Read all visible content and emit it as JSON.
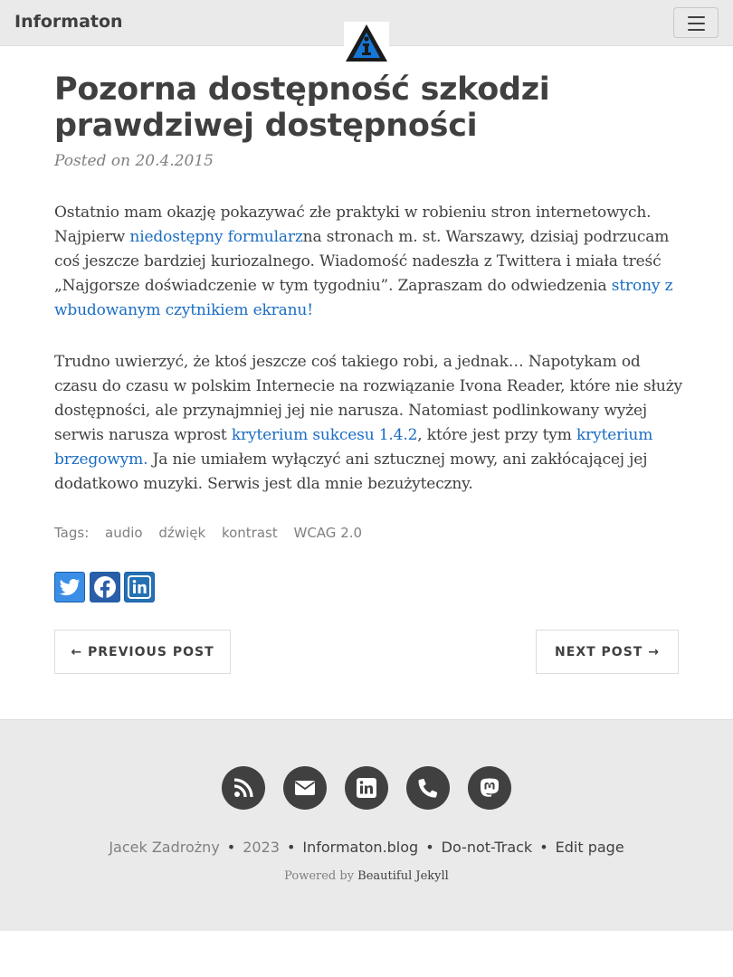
{
  "navbar": {
    "brand": "Informaton",
    "menu_icon": "hamburger-menu-icon",
    "logo_icon": "info-triangle-logo-icon"
  },
  "post": {
    "title": "Pozorna dostępność szkodzi prawdziwej dostępności",
    "posted_on": "Posted on 20.4.2015",
    "p1": {
      "t1": "Ostatnio mam okazję pokazywać złe praktyki w robieniu stron internetowych. Najpierw ",
      "link1": "niedostępny formularz",
      "t2": "na stronach m. st. Warszawy, dzisiaj podrzucam coś jeszcze bardziej kuriozalnego. Wiadomość nadeszła z Twittera i miała treść „Najgorsze doświadczenie w tym tygodniu”. Zapraszam do odwiedzenia ",
      "link2": "strony z wbudowanym czytnikiem ekranu!"
    },
    "p2": {
      "t1": "Trudno uwierzyć, że ktoś jeszcze coś takiego robi, a jednak… Napotykam od czasu do czasu w polskim Internecie na rozwiązanie Ivona Reader, które nie służy dostępności, ale przynajmniej jej nie narusza. Natomiast podlinkowany wyżej serwis narusza wprost ",
      "link1": "kryterium sukcesu 1.4.2",
      "t2": ", które jest przy tym ",
      "link2": "kryterium brzegowym.",
      "t3": " Ja nie umiałem wyłączyć ani sztucznej mowy, ani zakłócającej jej dodatkowo muzyki. Serwis jest dla mnie bezużyteczny."
    },
    "tags_label": "Tags:",
    "tags": [
      "audio",
      "dźwięk",
      "kontrast",
      "WCAG 2.0"
    ],
    "share": {
      "twitter_icon": "twitter-icon",
      "facebook_icon": "facebook-icon",
      "linkedin_icon": "linkedin-icon"
    },
    "pager": {
      "previous": "← PREVIOUS POST",
      "next": "NEXT POST →"
    }
  },
  "footer": {
    "icons": [
      "rss-icon",
      "envelope-icon",
      "linkedin-icon",
      "phone-icon",
      "mastodon-icon"
    ],
    "author": "Jacek Zadrożny",
    "year": "2023",
    "site": "Informaton.blog",
    "dnt": "Do-not-Track",
    "edit": "Edit page",
    "sep": "•",
    "powered_prefix": "Powered by ",
    "powered_link": "Beautiful Jekyll"
  },
  "colors": {
    "link": "#1a6dc2",
    "text": "#404040",
    "muted": "#808080",
    "navbar_bg": "#eaeaea",
    "footer_bg": "#eaeaea"
  }
}
